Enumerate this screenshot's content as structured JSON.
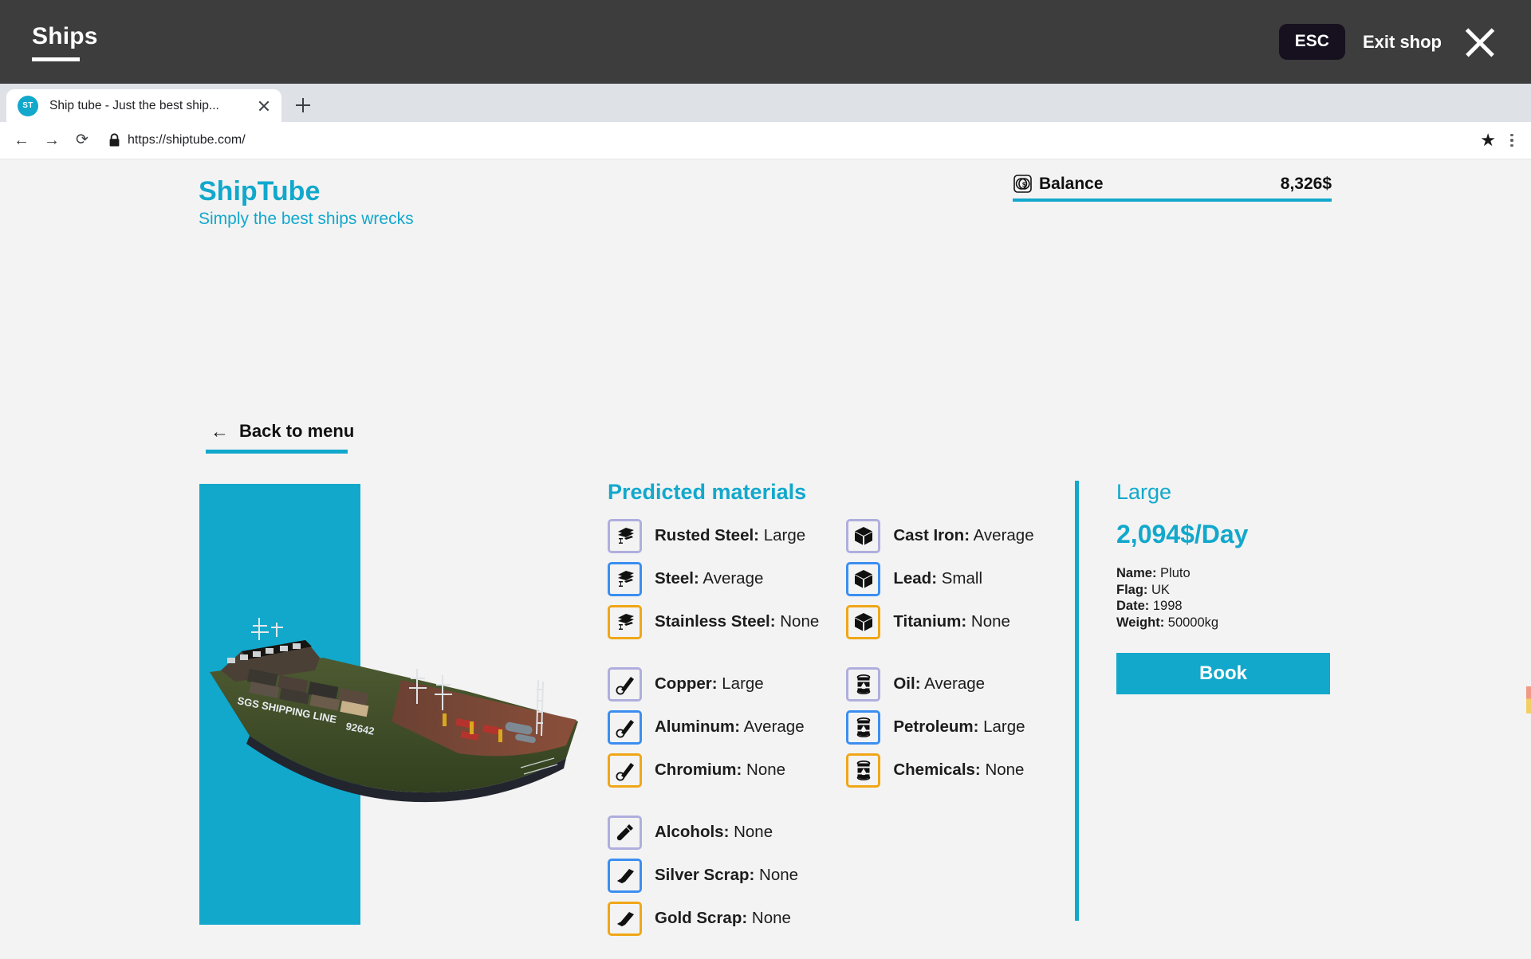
{
  "game_bar": {
    "title": "Ships",
    "esc_key": "ESC",
    "exit_label": "Exit shop",
    "close_icon": "close-icon"
  },
  "browser": {
    "tab": {
      "favicon_text": "ST",
      "title": "Ship tube - Just the best ship..."
    },
    "new_tab_icon": "plus-icon",
    "back_icon": "←",
    "forward_icon": "→",
    "reload_icon": "⟳",
    "lock_icon": "🔒",
    "url": "https://shiptube.com/",
    "bookmark_icon": "★",
    "menu_icon": "kebab-icon"
  },
  "site": {
    "brand": "ShipTube",
    "tagline": "Simply the best ships wrecks",
    "balance_label": "Balance",
    "balance_value": "8,326$",
    "back_label": "Back to menu",
    "back_arrow": "←"
  },
  "materials": {
    "title": "Predicted materials",
    "groups": [
      {
        "left": [
          {
            "icon": "beam-icon",
            "tier": "tier-1",
            "name": "Rusted Steel",
            "value": "Large"
          },
          {
            "icon": "beam-icon",
            "tier": "tier-2",
            "name": "Steel",
            "value": "Average"
          },
          {
            "icon": "beam-icon",
            "tier": "tier-3",
            "name": "Stainless Steel",
            "value": "None"
          }
        ],
        "right": [
          {
            "icon": "cube-icon",
            "tier": "tier-1",
            "name": "Cast Iron",
            "value": "Average"
          },
          {
            "icon": "cube-icon",
            "tier": "tier-2",
            "name": "Lead",
            "value": "Small"
          },
          {
            "icon": "cube-icon",
            "tier": "tier-3",
            "name": "Titanium",
            "value": "None"
          }
        ]
      },
      {
        "left": [
          {
            "icon": "pipe-icon",
            "tier": "tier-1",
            "name": "Copper",
            "value": "Large"
          },
          {
            "icon": "pipe-icon",
            "tier": "tier-2",
            "name": "Aluminum",
            "value": "Average"
          },
          {
            "icon": "pipe-icon",
            "tier": "tier-3",
            "name": "Chromium",
            "value": "None"
          }
        ],
        "right": [
          {
            "icon": "barrel-icon",
            "tier": "tier-1",
            "name": "Oil",
            "value": "Average"
          },
          {
            "icon": "barrel-icon",
            "tier": "tier-2",
            "name": "Petroleum",
            "value": "Large"
          },
          {
            "icon": "barrel-icon",
            "tier": "tier-3",
            "name": "Chemicals",
            "value": "None"
          }
        ]
      },
      {
        "left": [
          {
            "icon": "bottle-icon",
            "tier": "tier-1",
            "name": "Alcohols",
            "value": "None"
          },
          {
            "icon": "ingot-icon",
            "tier": "tier-2",
            "name": "Silver Scrap",
            "value": "None"
          },
          {
            "icon": "ingot-icon",
            "tier": "tier-3",
            "name": "Gold Scrap",
            "value": "None"
          }
        ],
        "right": []
      }
    ]
  },
  "detail": {
    "size": "Large",
    "price": "2,094$/Day",
    "specs": [
      {
        "label": "Name:",
        "value": "Pluto"
      },
      {
        "label": "Flag:",
        "value": "UK"
      },
      {
        "label": "Date:",
        "value": "1998"
      },
      {
        "label": "Weight:",
        "value": "50000kg"
      }
    ],
    "book_label": "Book"
  },
  "ship_art": {
    "hull_text": "SGS SHIPPING LINE",
    "hull_number": "92642"
  },
  "colors": {
    "accent": "#12a8cc",
    "game_bar": "#3d3d3d",
    "page_bg": "#f3f3f3",
    "tier_1": "#b0aede",
    "tier_2": "#3b8ef0",
    "tier_3": "#f0a616"
  }
}
